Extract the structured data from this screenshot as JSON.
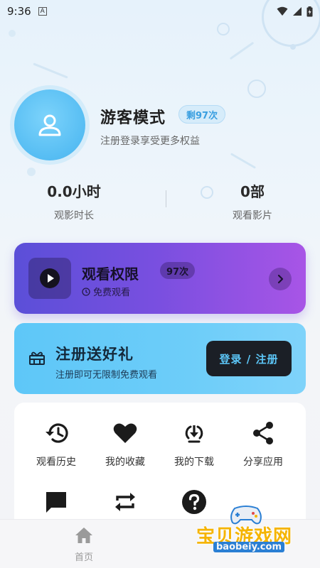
{
  "status_bar": {
    "time": "9:36",
    "notif_letter": "A"
  },
  "profile": {
    "name": "游客模式",
    "remain_badge": "剩97次",
    "subtitle": "注册登录享受更多权益"
  },
  "stats": [
    {
      "value": "0.0小时",
      "label": "观影时长"
    },
    {
      "value": "0部",
      "label": "观看影片"
    }
  ],
  "permission_card": {
    "title": "观看权限",
    "badge": "97次",
    "subtitle": "免费观看"
  },
  "register_card": {
    "title": "注册送好礼",
    "subtitle": "注册即可无限制免费观看",
    "button": "登录 / 注册"
  },
  "grid": [
    {
      "label": "观看历史",
      "icon": "history-icon"
    },
    {
      "label": "我的收藏",
      "icon": "heart-icon"
    },
    {
      "label": "我的下载",
      "icon": "download-icon"
    },
    {
      "label": "分享应用",
      "icon": "share-icon"
    },
    {
      "label": "",
      "icon": "feedback-icon"
    },
    {
      "label": "",
      "icon": "switch-icon"
    },
    {
      "label": "",
      "icon": "help-icon"
    }
  ],
  "bottom_nav": {
    "home_label": "首页"
  },
  "watermark": {
    "text": "宝贝游戏网",
    "url": "baobeiy.com"
  },
  "colors": {
    "accent_blue": "#5ec7f8",
    "perm_gradient_start": "#5b4fd8",
    "perm_gradient_end": "#a855e6",
    "button_dark": "#1b1f26"
  }
}
